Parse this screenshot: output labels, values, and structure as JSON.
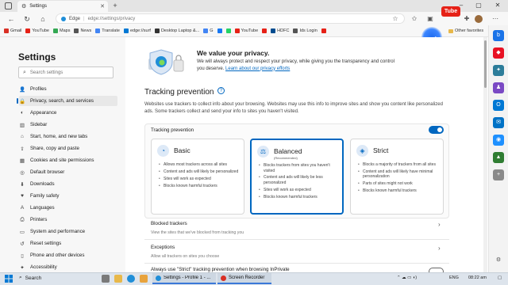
{
  "browser": {
    "tab_title": "Settings",
    "url_prefix": "Edge",
    "url_path": "edge://settings/privacy",
    "youtube_badge": "Tube"
  },
  "favorites": [
    {
      "label": "Gmail",
      "color": "#d93025"
    },
    {
      "label": "YouTube",
      "color": "#e62117"
    },
    {
      "label": "Maps",
      "color": "#34a853"
    },
    {
      "label": "News",
      "color": "#555555"
    },
    {
      "label": "Translate",
      "color": "#4285f4"
    },
    {
      "label": "edge://surf",
      "color": "#0078d4"
    },
    {
      "label": "Desktop Laptop &...",
      "color": "#333333"
    },
    {
      "label": "G",
      "color": "#4285f4"
    },
    {
      "label": "",
      "color": "#1877f2"
    },
    {
      "label": "",
      "color": "#25d366"
    },
    {
      "label": "YouTube",
      "color": "#e62117"
    },
    {
      "label": "",
      "color": "#e62117"
    },
    {
      "label": "HDFC",
      "color": "#004c8f"
    },
    {
      "label": "Ids Login",
      "color": "#555555"
    },
    {
      "label": "",
      "color": "#e62117"
    }
  ],
  "other_favorites": "Other favorites",
  "sidebar": {
    "title": "Settings",
    "search_placeholder": "Search settings",
    "items": [
      {
        "label": "Profiles",
        "icon": "👤"
      },
      {
        "label": "Privacy, search, and services",
        "icon": "🔒"
      },
      {
        "label": "Appearance",
        "icon": "◐"
      },
      {
        "label": "Sidebar",
        "icon": "▥"
      },
      {
        "label": "Start, home, and new tabs",
        "icon": "⌂"
      },
      {
        "label": "Share, copy and paste",
        "icon": "⇪"
      },
      {
        "label": "Cookies and site permissions",
        "icon": "▦"
      },
      {
        "label": "Default browser",
        "icon": "◎"
      },
      {
        "label": "Downloads",
        "icon": "⬇"
      },
      {
        "label": "Family safety",
        "icon": "♥"
      },
      {
        "label": "Languages",
        "icon": "A"
      },
      {
        "label": "Printers",
        "icon": "⎙"
      },
      {
        "label": "System and performance",
        "icon": "▭"
      },
      {
        "label": "Reset settings",
        "icon": "↺"
      },
      {
        "label": "Phone and other devices",
        "icon": "▯"
      },
      {
        "label": "Accessibility",
        "icon": "✦"
      }
    ]
  },
  "privacy": {
    "title": "We value your privacy.",
    "desc": "We will always protect and respect your privacy, while giving you the transparency and control you deserve.",
    "link": "Learn about our privacy efforts"
  },
  "tracking": {
    "title": "Tracking prevention",
    "desc": "Websites use trackers to collect info about your browsing. Websites may use this info to improve sites and show you content like personalized ads. Some trackers collect and send your info to sites you haven't visited.",
    "toggle_label": "Tracking prevention",
    "options": [
      {
        "name": "Basic",
        "recommended": "",
        "bullets": [
          "Allows most trackers across all sites",
          "Content and ads will likely be personalized",
          "Sites will work as expected",
          "Blocks known harmful trackers"
        ]
      },
      {
        "name": "Balanced",
        "recommended": "(Recommended)",
        "bullets": [
          "Blocks trackers from sites you haven't visited",
          "Content and ads will likely be less personalized",
          "Sites will work as expected",
          "Blocks known harmful trackers"
        ]
      },
      {
        "name": "Strict",
        "recommended": "",
        "bullets": [
          "Blocks a majority of trackers from all sites",
          "Content and ads will likely have minimal personalization",
          "Parts of sites might not work",
          "Blocks known harmful trackers"
        ]
      }
    ],
    "blocked_title": "Blocked trackers",
    "blocked_desc": "View the sites that we've blocked from tracking you",
    "exceptions_title": "Exceptions",
    "exceptions_desc": "Allow all trackers on sites you choose",
    "inprivate_text": "Always use \"Strict\" tracking prevention when browsing InPrivate"
  },
  "taskbar": {
    "search": "Search",
    "app1": "Settings - Profile 1 - ...",
    "app2": "Screen Recorder",
    "lang": "ENG",
    "time": "08:22 am"
  }
}
